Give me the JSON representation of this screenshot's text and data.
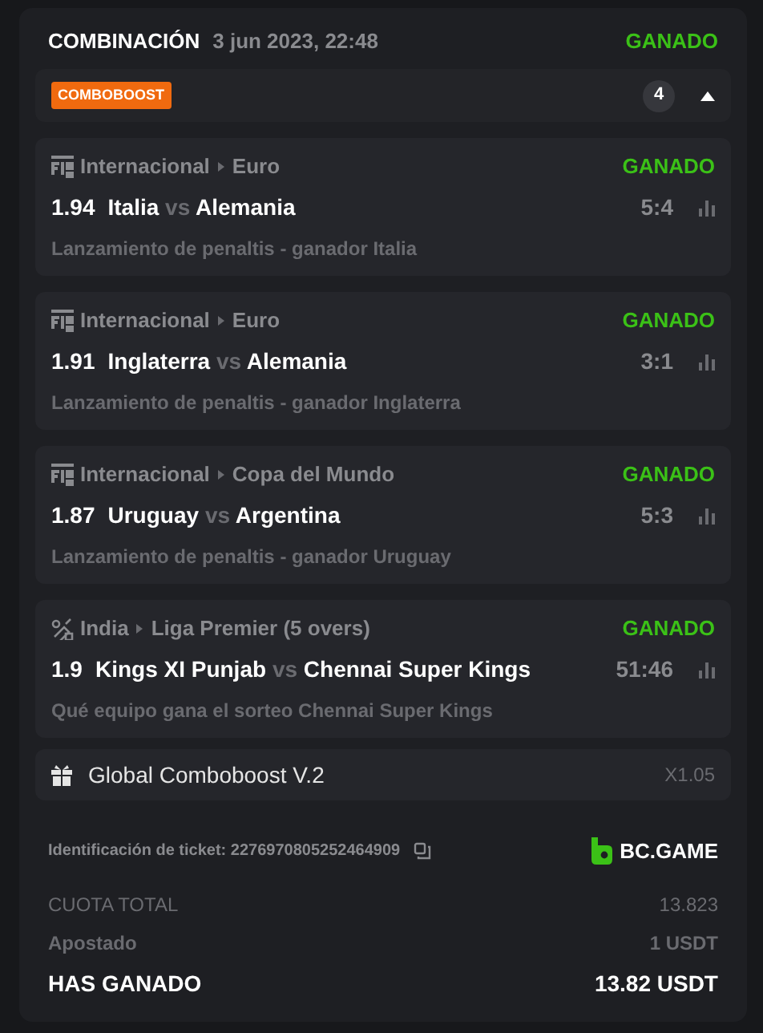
{
  "header": {
    "title": "COMBINACIÓN",
    "date": "3 jun 2023, 22:48",
    "status": "GANADO"
  },
  "comboboost": {
    "tag": "COMBOBOOST",
    "count": "4",
    "expanded": true
  },
  "bets": [
    {
      "kind": "fifa",
      "country": "Internacional",
      "league": "Euro",
      "status": "GANADO",
      "odds": "1.94",
      "home": "Italia",
      "vs": "vs",
      "away": "Alemania",
      "score": "5:4",
      "market": "Lanzamiento de penaltis - ganador Italia"
    },
    {
      "kind": "fifa",
      "country": "Internacional",
      "league": "Euro",
      "status": "GANADO",
      "odds": "1.91",
      "home": "Inglaterra",
      "vs": "vs",
      "away": "Alemania",
      "score": "3:1",
      "market": "Lanzamiento de penaltis - ganador Inglaterra"
    },
    {
      "kind": "fifa",
      "country": "Internacional",
      "league": "Copa del Mundo",
      "status": "GANADO",
      "odds": "1.87",
      "home": "Uruguay",
      "vs": "vs",
      "away": "Argentina",
      "score": "5:3",
      "market": "Lanzamiento de penaltis - ganador Uruguay"
    },
    {
      "kind": "cricket",
      "country": "India",
      "league": "Liga Premier (5 overs)",
      "status": "GANADO",
      "odds": "1.9",
      "home": "Kings XI Punjab",
      "vs": "vs",
      "away": "Chennai Super Kings",
      "score": "51:46",
      "market": "Qué equipo gana el sorteo Chennai Super Kings"
    }
  ],
  "boost": {
    "label": "Global Comboboost V.2",
    "multiplier": "X1.05"
  },
  "ticket": {
    "label": "Identificación de ticket: 2276970805252464909",
    "brand": "BC.GAME"
  },
  "totals": [
    {
      "kind": "muted",
      "label": "CUOTA TOTAL",
      "value": "13.823"
    },
    {
      "kind": "bold-muted",
      "label": "Apostado",
      "value": "1 USDT"
    },
    {
      "kind": "main",
      "label": "HAS GANADO",
      "value": "13.82 USDT"
    }
  ]
}
